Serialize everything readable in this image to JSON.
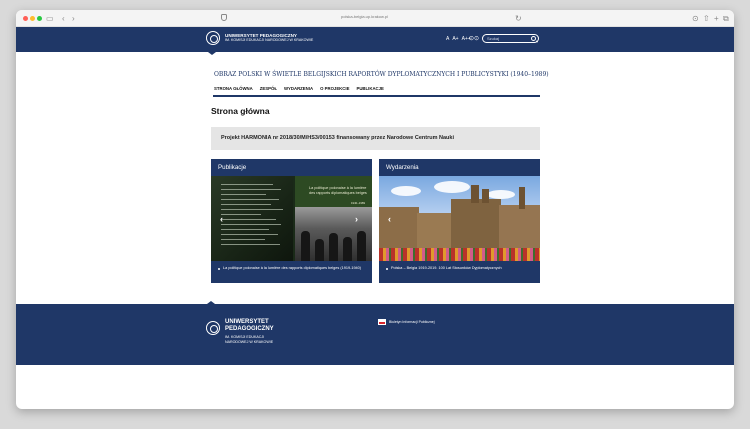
{
  "browser": {
    "url": "polska-belgia.up.krakow.pl"
  },
  "header": {
    "logo_line1": "UNIWERSYTET PEDAGOGICZNY",
    "logo_line2": "IM. KOMISJI EDUKACJI NARODOWEJ W KRAKOWIE",
    "font_sizes": [
      "A",
      "A+",
      "A++"
    ],
    "search_placeholder": "Szukaj"
  },
  "project_title": "OBRAZ POLSKI W ŚWIETLE BELGIJSKICH RAPORTÓW DYPLOMATYCZNYCH I PUBLICYSTYKI (1940–1989)",
  "nav": [
    "STRONA GŁÓWNA",
    "ZESPÓŁ",
    "WYDARZENIA",
    "O PROJEKCIE",
    "PUBLIKACJE"
  ],
  "page_title": "Strona główna",
  "project_box": "Projekt HARMONIA nr 2018/30/M/HS3/00153 finansowany przez Narodowe Centrum Nauki",
  "cards": {
    "publications": {
      "title": "Publikacje",
      "book_title": "La politique polonaise à la lumière des rapports diplomatiques belges",
      "book_years": "1940–1989",
      "caption": "La politique polonaise à la lumière des rapports diplomatiques belges (1919-1940)"
    },
    "events": {
      "title": "Wydarzenia",
      "caption": "Polska – Belgia 1919-2019. 100 Lat Stosunków Dyplomatycznych"
    }
  },
  "footer": {
    "line1": "UNIWERSYTET",
    "line2": "PEDAGOGICZNY",
    "line3": "IM. KOMISJI EDUKACJI",
    "line4": "NARODOWEJ W KRAKOWIE",
    "bip": "Biuletyn Informacji Publicznej"
  },
  "colors": {
    "brand_navy": "#1f3767",
    "project_box_bg": "#e5e5e5"
  }
}
